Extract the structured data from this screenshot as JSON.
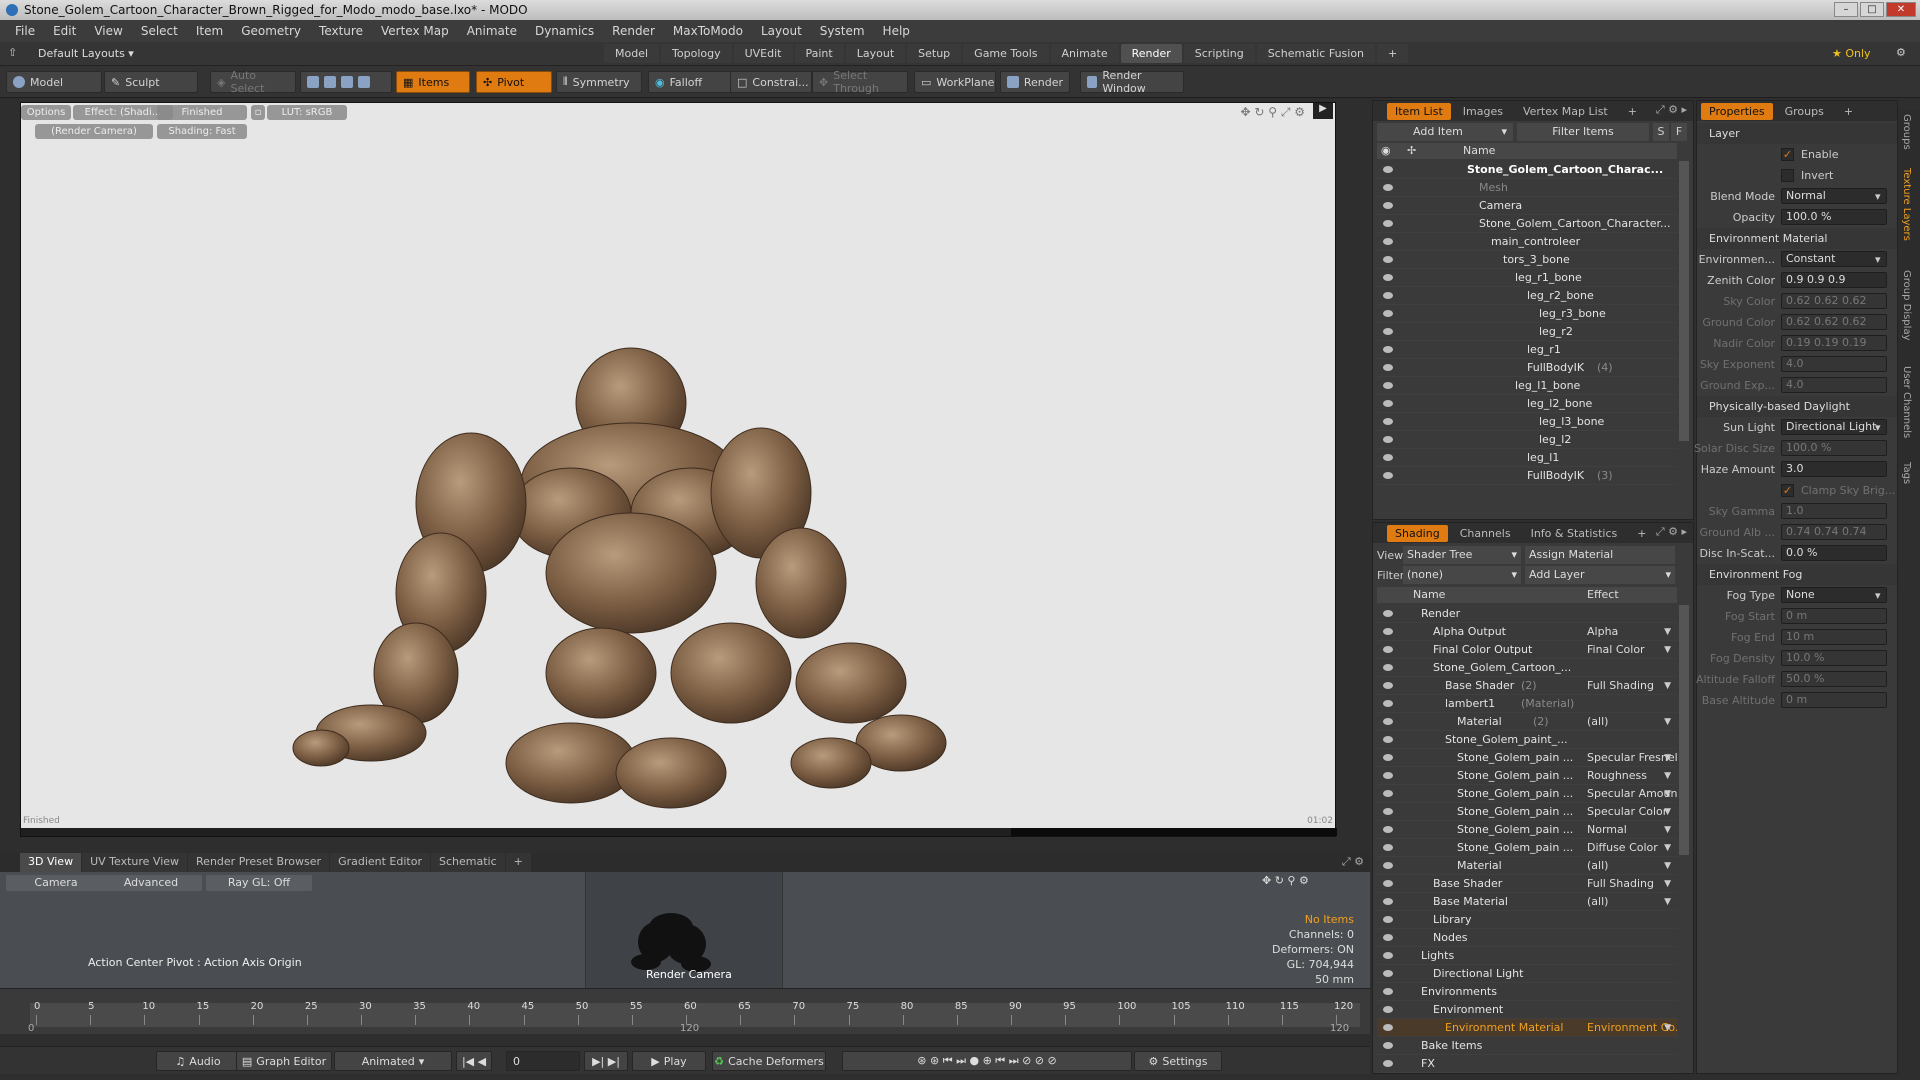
{
  "window": {
    "title": "Stone_Golem_Cartoon_Character_Brown_Rigged_for_Modo_modo_base.lxo* - MODO"
  },
  "menu": [
    "File",
    "Edit",
    "View",
    "Select",
    "Item",
    "Geometry",
    "Texture",
    "Vertex Map",
    "Animate",
    "Dynamics",
    "Render",
    "MaxToModo",
    "Layout",
    "System",
    "Help"
  ],
  "layout": {
    "preset": "Default Layouts ▾",
    "tabs": [
      "Model",
      "Topology",
      "UVEdit",
      "Paint",
      "Layout",
      "Setup",
      "Game Tools",
      "Animate",
      "Render",
      "Scripting",
      "Schematic Fusion",
      "+"
    ],
    "active": "Render",
    "only_label": "★ Only"
  },
  "toolbar": {
    "model": "Model",
    "sculpt": "Sculpt",
    "auto_select": "Auto Select",
    "items": "Items",
    "pivot": "Pivot",
    "symmetry": "Symmetry",
    "falloff": "Falloff",
    "constraint": "Constrai...",
    "select_through": "Select Through",
    "workplane": "WorkPlane",
    "render": "Render",
    "render_window": "Render Window"
  },
  "viewport": {
    "options": "Options",
    "effect": "Effect: (Shadi...",
    "finished": "Finished",
    "lut": "LUT: sRGB",
    "camera": "(Render Camera)",
    "shading": "Shading: Fast",
    "status_left": "Finished",
    "status_right": "01:02"
  },
  "bottom": {
    "tabs": [
      "3D View",
      "UV Texture View",
      "Render Preset Browser",
      "Gradient Editor",
      "Schematic",
      "+"
    ],
    "camera_btn": "Camera",
    "advanced_btn": "Advanced",
    "raygl_btn": "Ray GL: Off",
    "action_center": "Action Center Pivot : Action Axis Origin",
    "cam_label": "Render Camera",
    "stats": {
      "no_items": "No Items",
      "channels": "Channels: 0",
      "deformers": "Deformers: ON",
      "gl": "GL: 704,944",
      "distance": "50 mm"
    }
  },
  "timeline": {
    "ticks": [
      "0",
      "5",
      "10",
      "15",
      "20",
      "25",
      "30",
      "35",
      "40",
      "45",
      "50",
      "55",
      "60",
      "65",
      "70",
      "75",
      "80",
      "85",
      "90",
      "95",
      "100",
      "105",
      "110",
      "115",
      "120"
    ],
    "low": "0",
    "mid": "120",
    "high": "120"
  },
  "transport": {
    "audio": "Audio",
    "graph_editor": "Graph Editor",
    "animated": "Animated",
    "frame": "0",
    "play": "Play",
    "cache_deformers": "Cache Deformers",
    "settings": "Settings"
  },
  "itemlist": {
    "tabs": [
      "Item List",
      "Images",
      "Vertex Map List",
      "+"
    ],
    "add_item": "Add Item",
    "filter_items": "Filter Items",
    "name_header": "Name",
    "rows": [
      {
        "label": "Stone_Golem_Cartoon_Charac...",
        "indent": 0
      },
      {
        "label": "Mesh",
        "indent": 1,
        "dim": true
      },
      {
        "label": "Camera",
        "indent": 1
      },
      {
        "label": "Stone_Golem_Cartoon_Character...",
        "indent": 1
      },
      {
        "label": "main_controleer",
        "indent": 2
      },
      {
        "label": "tors_3_bone",
        "indent": 3
      },
      {
        "label": "leg_r1_bone",
        "indent": 4
      },
      {
        "label": "leg_r2_bone",
        "indent": 5
      },
      {
        "label": "leg_r3_bone",
        "indent": 6
      },
      {
        "label": "leg_r2",
        "indent": 6
      },
      {
        "label": "leg_r1",
        "indent": 5
      },
      {
        "label": "FullBodyIK",
        "extra": "(4)",
        "indent": 5
      },
      {
        "label": "leg_l1_bone",
        "indent": 4
      },
      {
        "label": "leg_l2_bone",
        "indent": 5
      },
      {
        "label": "leg_l3_bone",
        "indent": 6
      },
      {
        "label": "leg_l2",
        "indent": 6
      },
      {
        "label": "leg_l1",
        "indent": 5
      },
      {
        "label": "FullBodyIK",
        "extra": "(3)",
        "indent": 5
      }
    ]
  },
  "shading": {
    "tabs": [
      "Shading",
      "Channels",
      "Info & Statistics",
      "+"
    ],
    "view_label": "View",
    "view_value": "Shader Tree",
    "assign_material": "Assign Material",
    "filter_label": "Filter",
    "filter_value": "(none)",
    "add_layer": "Add Layer",
    "name_header": "Name",
    "effect_header": "Effect",
    "rows": [
      {
        "label": "Render",
        "effect": "",
        "indent": 0
      },
      {
        "label": "Alpha Output",
        "effect": "Alpha",
        "indent": 1
      },
      {
        "label": "Final Color Output",
        "effect": "Final Color",
        "indent": 1
      },
      {
        "label": "Stone_Golem_Cartoon_...",
        "effect": "",
        "indent": 1
      },
      {
        "label": "Base Shader",
        "extra": "(2)",
        "effect": "Full Shading",
        "indent": 2
      },
      {
        "label": "lambert1",
        "extra": "(Material)",
        "effect": "",
        "indent": 2
      },
      {
        "label": "Material",
        "extra": "(2)",
        "effect": "(all)",
        "indent": 3
      },
      {
        "label": "Stone_Golem_paint_...",
        "effect": "",
        "indent": 2
      },
      {
        "label": "Stone_Golem_pain ...",
        "effect": "Specular Fresnel",
        "indent": 3
      },
      {
        "label": "Stone_Golem_pain ...",
        "effect": "Roughness",
        "indent": 3
      },
      {
        "label": "Stone_Golem_pain ...",
        "effect": "Specular Amount",
        "indent": 3
      },
      {
        "label": "Stone_Golem_pain ...",
        "effect": "Specular Color",
        "indent": 3
      },
      {
        "label": "Stone_Golem_pain ...",
        "effect": "Normal",
        "indent": 3
      },
      {
        "label": "Stone_Golem_pain ...",
        "effect": "Diffuse Color",
        "indent": 3
      },
      {
        "label": "Material",
        "effect": "(all)",
        "indent": 3
      },
      {
        "label": "Base Shader",
        "effect": "Full Shading",
        "indent": 1
      },
      {
        "label": "Base Material",
        "effect": "(all)",
        "indent": 1
      },
      {
        "label": "Library",
        "effect": "",
        "indent": 1
      },
      {
        "label": "Nodes",
        "effect": "",
        "indent": 1
      },
      {
        "label": "Lights",
        "effect": "",
        "indent": 0
      },
      {
        "label": "Directional Light",
        "effect": "",
        "indent": 1
      },
      {
        "label": "Environments",
        "effect": "",
        "indent": 0
      },
      {
        "label": "Environment",
        "effect": "",
        "indent": 1
      },
      {
        "label": "Environment Material",
        "effect": "Environment Co...",
        "indent": 2,
        "selected": true
      },
      {
        "label": "Bake Items",
        "effect": "",
        "indent": 0
      },
      {
        "label": "FX",
        "effect": "",
        "indent": 0
      }
    ]
  },
  "properties": {
    "tabs": [
      "Properties",
      "Groups",
      "+"
    ],
    "layer_section": "Layer",
    "enable": "Enable",
    "invert": "Invert",
    "blend_mode_label": "Blend Mode",
    "blend_mode": "Normal",
    "opacity_label": "Opacity",
    "opacity": "100.0 %",
    "env_section": "Environment Material",
    "environment_label": "Environmen...",
    "environment": "Constant",
    "zenith_label": "Zenith Color",
    "zenith": "0.9   0.9   0.9",
    "sky_label": "Sky Color",
    "sky": "0.62  0.62  0.62",
    "ground_label": "Ground Color",
    "ground": "0.62  0.62  0.62",
    "nadir_label": "Nadir Color",
    "nadir": "0.19  0.19  0.19",
    "skyexp_label": "Sky Exponent",
    "skyexp": "4.0",
    "groundexp_label": "Ground Exp...",
    "groundexp": "4.0",
    "daylight_section": "Physically-based Daylight",
    "sunlight_label": "Sun Light",
    "sunlight": "Directional Light",
    "solardisc_label": "Solar Disc Size",
    "solardisc": "100.0 %",
    "haze_label": "Haze Amount",
    "haze": "3.0",
    "clamp_label": "Clamp Sky Brig...",
    "skygamma_label": "Sky Gamma",
    "skygamma": "1.0",
    "groundalb_label": "Ground Alb ...",
    "groundalb": "0.74  0.74  0.74",
    "discin_label": "Disc In-Scat...",
    "discin": "0.0 %",
    "fog_section": "Environment Fog",
    "fogtype_label": "Fog Type",
    "fogtype": "None",
    "fogstart_label": "Fog Start",
    "fogstart": "0 m",
    "fogend_label": "Fog End",
    "fogend": "10 m",
    "fogdensity_label": "Fog Density",
    "fogdensity": "10.0 %",
    "altfalloff_label": "Altitude Falloff",
    "altfalloff": "50.0 %",
    "basealt_label": "Base Altitude",
    "basealt": "0 m"
  },
  "side_tabs": [
    "Groups",
    "Texture Layers",
    "Group Display",
    "User Channels",
    "Tags"
  ],
  "colors": {
    "accent": "#e07b12",
    "viewport_bg": "#e6e6e6",
    "stone": "#8a6e52"
  }
}
